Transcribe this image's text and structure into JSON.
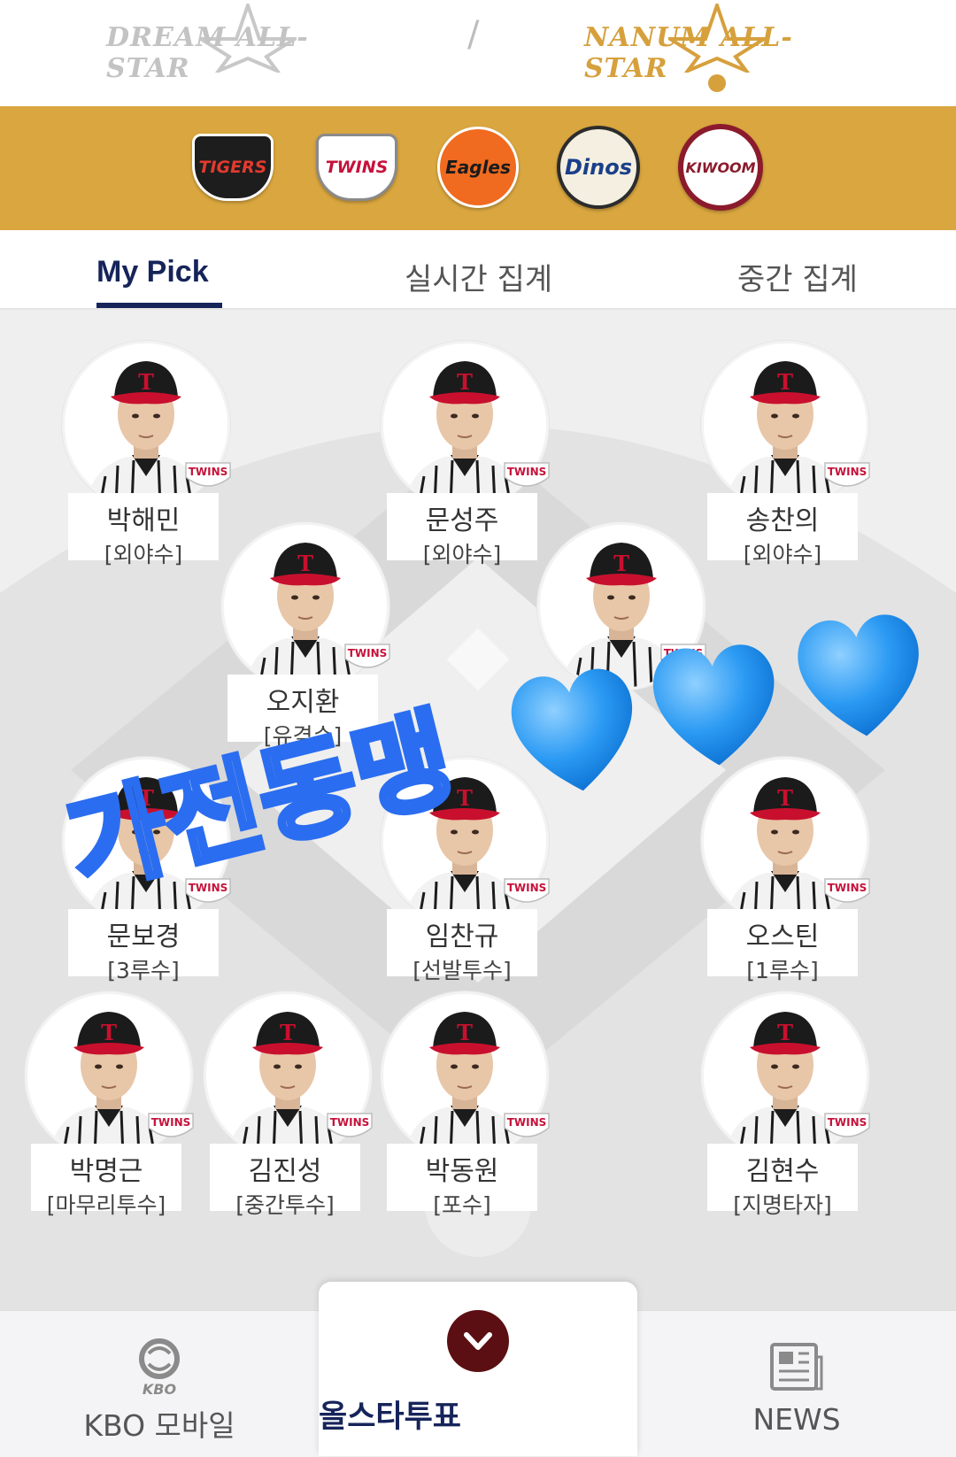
{
  "header": {
    "dream_label": "DREAM ALL-STAR",
    "nanum_label": "NANUM ALL-STAR",
    "divider": "/"
  },
  "teams": [
    {
      "name": "TIGERS",
      "icon": "tigers-logo"
    },
    {
      "name": "TWINS",
      "icon": "twins-logo"
    },
    {
      "name": "Eagles",
      "icon": "eagles-logo"
    },
    {
      "name": "Dinos",
      "icon": "dinos-logo"
    },
    {
      "name": "KIWOOM",
      "icon": "kiwoom-logo"
    }
  ],
  "tabs": [
    {
      "label": "My Pick"
    },
    {
      "label": "실시간 집계"
    },
    {
      "label": "중간 집계"
    }
  ],
  "players": [
    {
      "name": "박해민",
      "position": "[외야수]"
    },
    {
      "name": "문성주",
      "position": "[외야수]"
    },
    {
      "name": "송찬의",
      "position": "[외야수]"
    },
    {
      "name": "오지환",
      "position": "[유격수]"
    },
    {
      "name": "문보경",
      "position": "[3루수]"
    },
    {
      "name": "임찬규",
      "position": "[선발투수]"
    },
    {
      "name": "오스틴",
      "position": "[1루수]"
    },
    {
      "name": "박명근",
      "position": "[마무리투수]"
    },
    {
      "name": "김진성",
      "position": "[중간투수]"
    },
    {
      "name": "박동원",
      "position": "[포수]"
    },
    {
      "name": "김현수",
      "position": "[지명타자]"
    }
  ],
  "badge_label": "TWINS",
  "overlay_text": "가전동맹",
  "bottom_nav": {
    "kbo_label": "KBO 모바일",
    "kbo_logo_text": "KBO",
    "vote_label": "올스타투표",
    "news_label": "NEWS"
  },
  "colors": {
    "gold": "#d9a63f",
    "navy": "#16245a",
    "vote_button": "#5b0f12",
    "heart": "#2b9af3",
    "overlay_text": "#2a6df0"
  }
}
